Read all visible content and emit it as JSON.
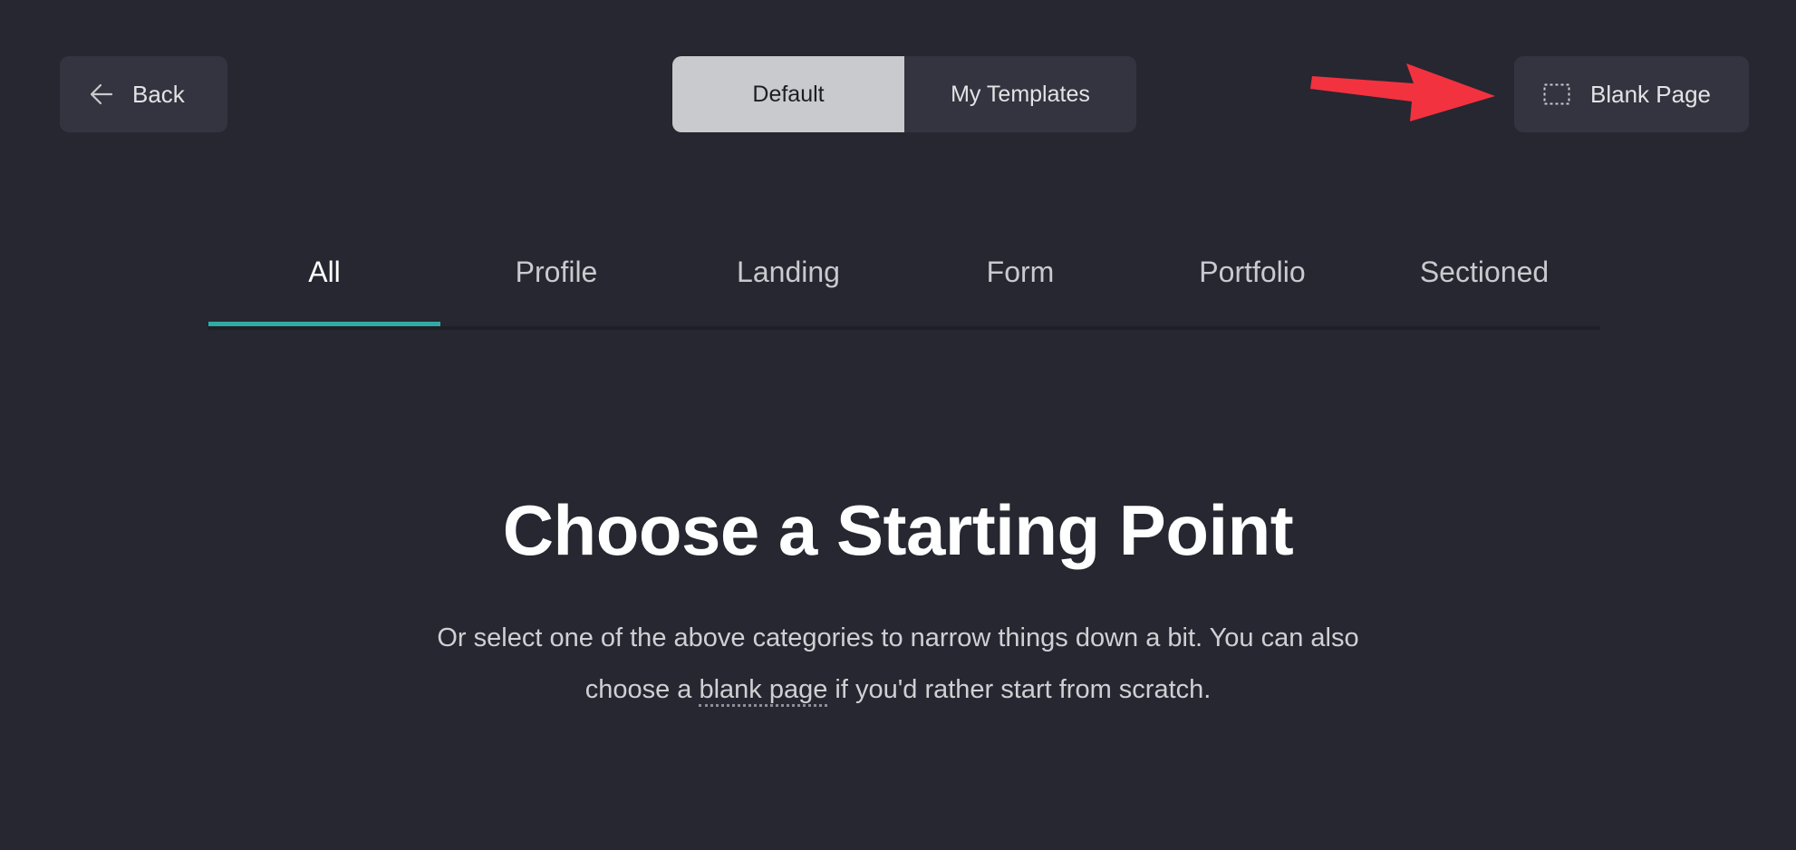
{
  "header": {
    "back_label": "Back",
    "segments": [
      {
        "label": "Default",
        "active": true
      },
      {
        "label": "My Templates",
        "active": false
      }
    ],
    "blank_page_label": "Blank Page"
  },
  "tabs": [
    {
      "label": "All",
      "active": true
    },
    {
      "label": "Profile",
      "active": false
    },
    {
      "label": "Landing",
      "active": false
    },
    {
      "label": "Form",
      "active": false
    },
    {
      "label": "Portfolio",
      "active": false
    },
    {
      "label": "Sectioned",
      "active": false
    }
  ],
  "main": {
    "title": "Choose a Starting Point",
    "desc_before": "Or select one of the above categories to narrow things down a bit. You can also choose a ",
    "desc_link": "blank page",
    "desc_after": " if you'd rather start from scratch."
  },
  "icons": {
    "back": "arrow-left-icon",
    "blank_page": "dashed-rectangle-icon",
    "annotation": "red-arrow-annotation"
  },
  "colors": {
    "background": "#262730",
    "button_bg": "#33343f",
    "segment_active_bg": "#c9cacd",
    "tab_underline": "#31aaa4",
    "annotation_arrow": "#f2323f"
  }
}
